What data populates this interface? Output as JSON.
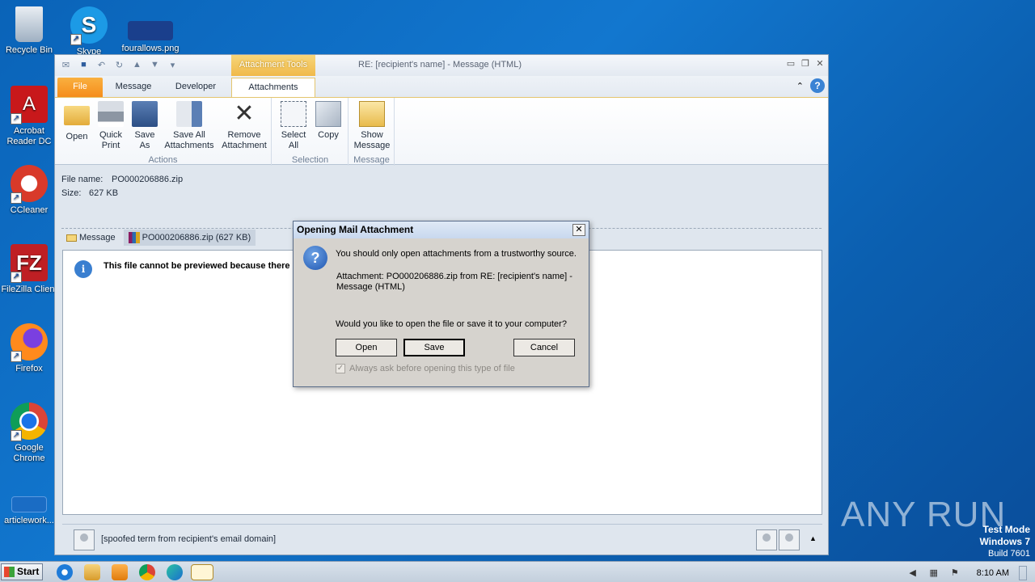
{
  "desktop": {
    "icons": [
      {
        "label": "Recycle Bin",
        "icon": "recycle-bin-icon"
      },
      {
        "label": "Skype",
        "icon": "skype-icon"
      },
      {
        "label": "fourallows.png",
        "icon": "image-file-icon"
      },
      {
        "label": "Acrobat Reader DC",
        "icon": "acrobat-icon"
      },
      {
        "label": "CCleaner",
        "icon": "ccleaner-icon"
      },
      {
        "label": "FileZilla Client",
        "icon": "filezilla-icon"
      },
      {
        "label": "Firefox",
        "icon": "firefox-icon"
      },
      {
        "label": "Google Chrome",
        "icon": "chrome-icon"
      },
      {
        "label": "articlework...",
        "icon": "document-icon"
      }
    ]
  },
  "window": {
    "context_tab": "Attachment Tools",
    "title": "RE: [recipient's name]  -  Message (HTML)",
    "tabs": [
      "File",
      "Message",
      "Developer",
      "Attachments"
    ],
    "ribbon": {
      "groups": [
        {
          "label": "Actions",
          "buttons": [
            "Open",
            "Quick Print",
            "Save As",
            "Save All Attachments",
            "Remove Attachment"
          ]
        },
        {
          "label": "Selection",
          "buttons": [
            "Select All",
            "Copy"
          ]
        },
        {
          "label": "Message",
          "buttons": [
            "Show Message"
          ]
        }
      ],
      "btn": {
        "open": "Open",
        "quick_print_1": "Quick",
        "quick_print_2": "Print",
        "save_as_1": "Save",
        "save_as_2": "As",
        "save_all_1": "Save All",
        "save_all_2": "Attachments",
        "remove_1": "Remove",
        "remove_2": "Attachment",
        "select_all_1": "Select",
        "select_all_2": "All",
        "copy": "Copy",
        "show_msg_1": "Show",
        "show_msg_2": "Message"
      }
    },
    "file_props": {
      "name_label": "File name:",
      "name_value": "PO000206886.zip",
      "size_label": "Size:",
      "size_value": "627 KB"
    },
    "attachment_tabs": {
      "message": "Message",
      "file": "PO000206886.zip (627 KB)"
    },
    "preview_message": "This file cannot be previewed because there is",
    "people_pane_email": "[spoofed term from recipient's email domain]"
  },
  "dialog": {
    "title": "Opening Mail Attachment",
    "warning": "You should only open attachments from a trustworthy source.",
    "attachment_line1": "Attachment: PO000206886.zip from RE: [recipient's name] -",
    "attachment_line2": "Message (HTML)",
    "question": "Would you like to open the file or save it to your computer?",
    "buttons": {
      "open": "Open",
      "save": "Save",
      "cancel": "Cancel"
    },
    "checkbox_label": "Always ask before opening this type of file",
    "checkbox_checked": true
  },
  "taskbar": {
    "start": "Start",
    "time": "8:10 AM",
    "apps": [
      "ie-icon",
      "explorer-icon",
      "media-player-icon",
      "chrome-icon",
      "edge-icon",
      "outlook-icon"
    ]
  },
  "watermark": "ANY RUN",
  "test_mode": {
    "line1": "Test Mode",
    "line2": "Windows 7",
    "line3": "Build 7601"
  }
}
